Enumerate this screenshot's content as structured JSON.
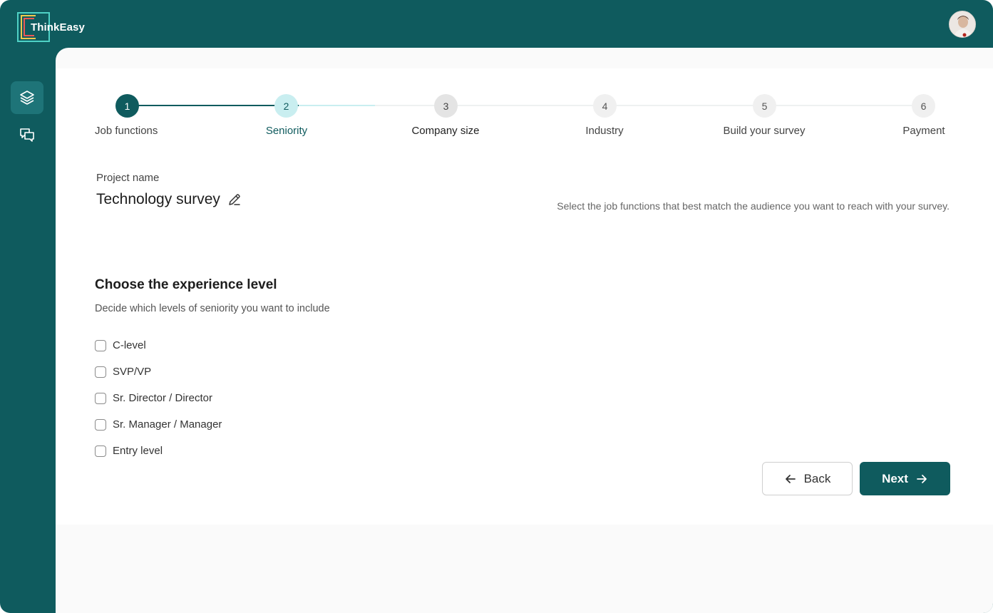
{
  "app": {
    "brand": "ThinkEasy",
    "colors": {
      "primary": "#0f5b5e",
      "current_step": "#c9eef0",
      "background": "#fafafa"
    }
  },
  "sidebar": {
    "items": [
      {
        "icon": "layers-icon",
        "active": true
      },
      {
        "icon": "chat-bubbles-icon",
        "active": false
      }
    ]
  },
  "stepper": {
    "steps": [
      {
        "number": "1",
        "label": "Job functions",
        "state": "done"
      },
      {
        "number": "2",
        "label": "Seniority",
        "state": "current"
      },
      {
        "number": "3",
        "label": "Company size",
        "state": "next"
      },
      {
        "number": "4",
        "label": "Industry",
        "state": "upcoming"
      },
      {
        "number": "5",
        "label": "Build your survey",
        "state": "upcoming"
      },
      {
        "number": "6",
        "label": "Payment",
        "state": "upcoming"
      }
    ]
  },
  "project": {
    "label": "Project name",
    "name": "Technology survey",
    "hint": "Select the job functions that best match the audience you want to reach with your survey."
  },
  "section": {
    "title": "Choose the experience level",
    "subtitle": "Decide which levels of seniority you want to include",
    "options": [
      {
        "label": "C-level",
        "checked": false
      },
      {
        "label": "SVP/VP",
        "checked": false
      },
      {
        "label": "Sr. Director / Director",
        "checked": false
      },
      {
        "label": "Sr. Manager / Manager",
        "checked": false
      },
      {
        "label": "Entry level",
        "checked": false
      }
    ]
  },
  "actions": {
    "back_label": "Back",
    "next_label": "Next"
  }
}
